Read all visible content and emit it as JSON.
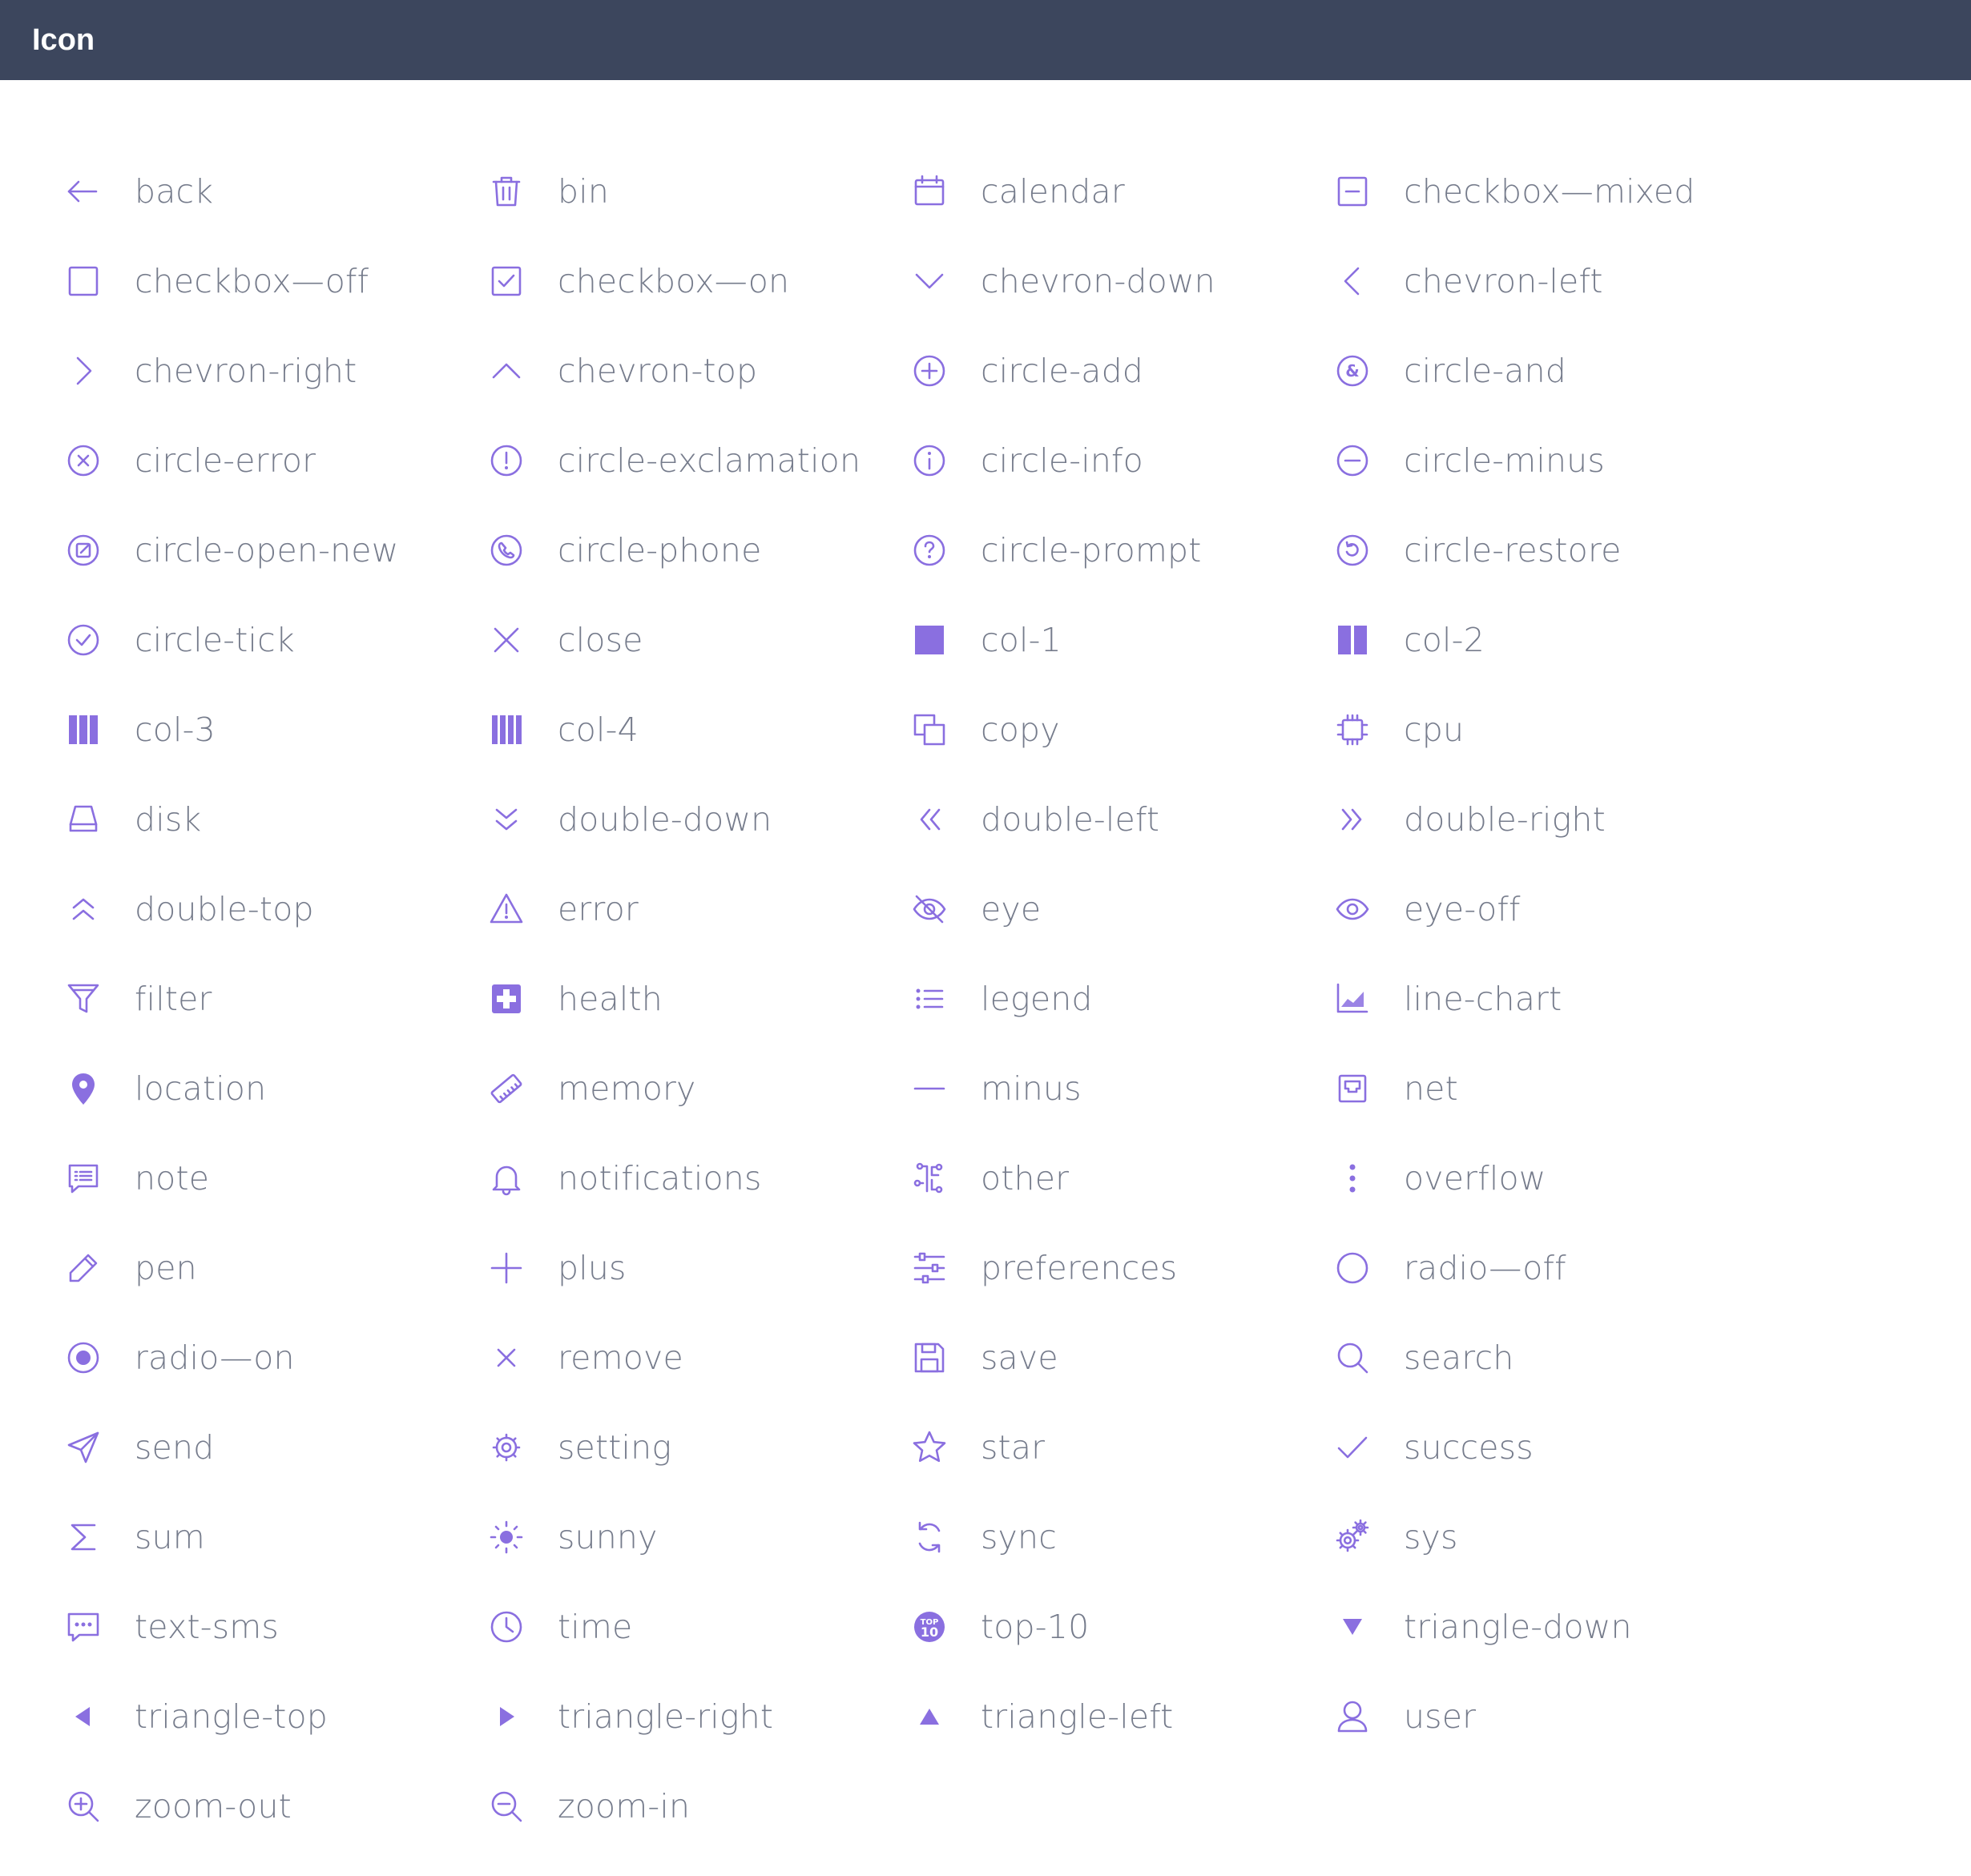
{
  "header": {
    "title": "Icon"
  },
  "accent": "#8a6fe0",
  "icons": [
    {
      "name": "back"
    },
    {
      "name": "bin"
    },
    {
      "name": "calendar"
    },
    {
      "name": "checkbox—mixed"
    },
    {
      "name": "checkbox—off"
    },
    {
      "name": "checkbox—on"
    },
    {
      "name": "chevron-down"
    },
    {
      "name": "chevron-left"
    },
    {
      "name": "chevron-right"
    },
    {
      "name": "chevron-top"
    },
    {
      "name": "circle-add"
    },
    {
      "name": "circle-and"
    },
    {
      "name": "circle-error"
    },
    {
      "name": "circle-exclamation"
    },
    {
      "name": "circle-info"
    },
    {
      "name": "circle-minus"
    },
    {
      "name": "circle-open-new"
    },
    {
      "name": "circle-phone"
    },
    {
      "name": "circle-prompt"
    },
    {
      "name": "circle-restore"
    },
    {
      "name": "circle-tick"
    },
    {
      "name": "close"
    },
    {
      "name": "col-1"
    },
    {
      "name": "col-2"
    },
    {
      "name": "col-3"
    },
    {
      "name": "col-4"
    },
    {
      "name": "copy"
    },
    {
      "name": "cpu"
    },
    {
      "name": "disk"
    },
    {
      "name": "double-down"
    },
    {
      "name": "double-left"
    },
    {
      "name": "double-right"
    },
    {
      "name": "double-top"
    },
    {
      "name": "error"
    },
    {
      "name": "eye"
    },
    {
      "name": "eye-off"
    },
    {
      "name": "filter"
    },
    {
      "name": "health"
    },
    {
      "name": "legend"
    },
    {
      "name": "line-chart"
    },
    {
      "name": "location"
    },
    {
      "name": "memory"
    },
    {
      "name": "minus"
    },
    {
      "name": "net"
    },
    {
      "name": "note"
    },
    {
      "name": "notifications"
    },
    {
      "name": "other"
    },
    {
      "name": "overflow"
    },
    {
      "name": "pen"
    },
    {
      "name": "plus"
    },
    {
      "name": "preferences"
    },
    {
      "name": "radio—off"
    },
    {
      "name": "radio—on"
    },
    {
      "name": "remove"
    },
    {
      "name": "save"
    },
    {
      "name": "search"
    },
    {
      "name": "send"
    },
    {
      "name": "setting"
    },
    {
      "name": "star"
    },
    {
      "name": "success"
    },
    {
      "name": "sum"
    },
    {
      "name": "sunny"
    },
    {
      "name": "sync"
    },
    {
      "name": "sys"
    },
    {
      "name": "text-sms"
    },
    {
      "name": "time"
    },
    {
      "name": "top-10"
    },
    {
      "name": "triangle-down"
    },
    {
      "name": "triangle-top"
    },
    {
      "name": "triangle-right"
    },
    {
      "name": "triangle-left"
    },
    {
      "name": "user"
    },
    {
      "name": "zoom-out"
    },
    {
      "name": "zoom-in"
    }
  ]
}
